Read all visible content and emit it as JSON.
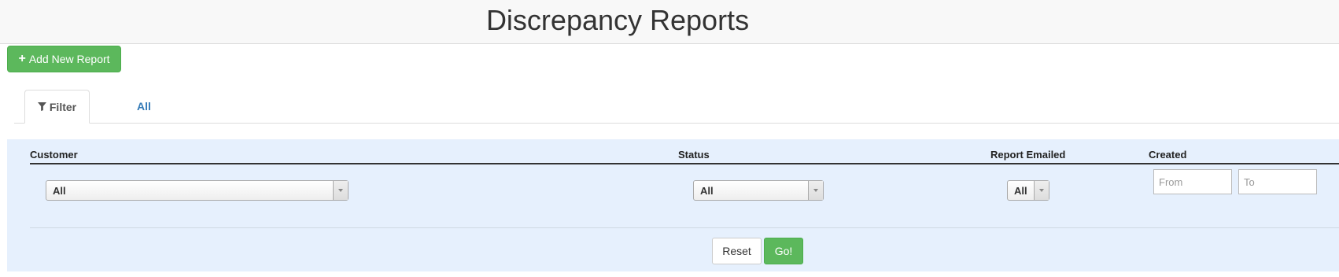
{
  "header": {
    "title": "Discrepancy Reports"
  },
  "toolbar": {
    "add_label": "Add New Report"
  },
  "tabs": [
    {
      "label": "Filter",
      "icon": "filter-icon",
      "active": true
    },
    {
      "label": "All",
      "active": false
    }
  ],
  "filters": {
    "customer": {
      "label": "Customer",
      "value": "All"
    },
    "status": {
      "label": "Status",
      "value": "All"
    },
    "report_emailed": {
      "label": "Report Emailed",
      "value": "All"
    },
    "created": {
      "label": "Created",
      "from_placeholder": "From",
      "to_placeholder": "To"
    }
  },
  "actions": {
    "reset_label": "Reset",
    "go_label": "Go!"
  },
  "colors": {
    "primary_green": "#5cb85c",
    "link_blue": "#337ab7",
    "panel_bg": "#e6f0fd"
  }
}
